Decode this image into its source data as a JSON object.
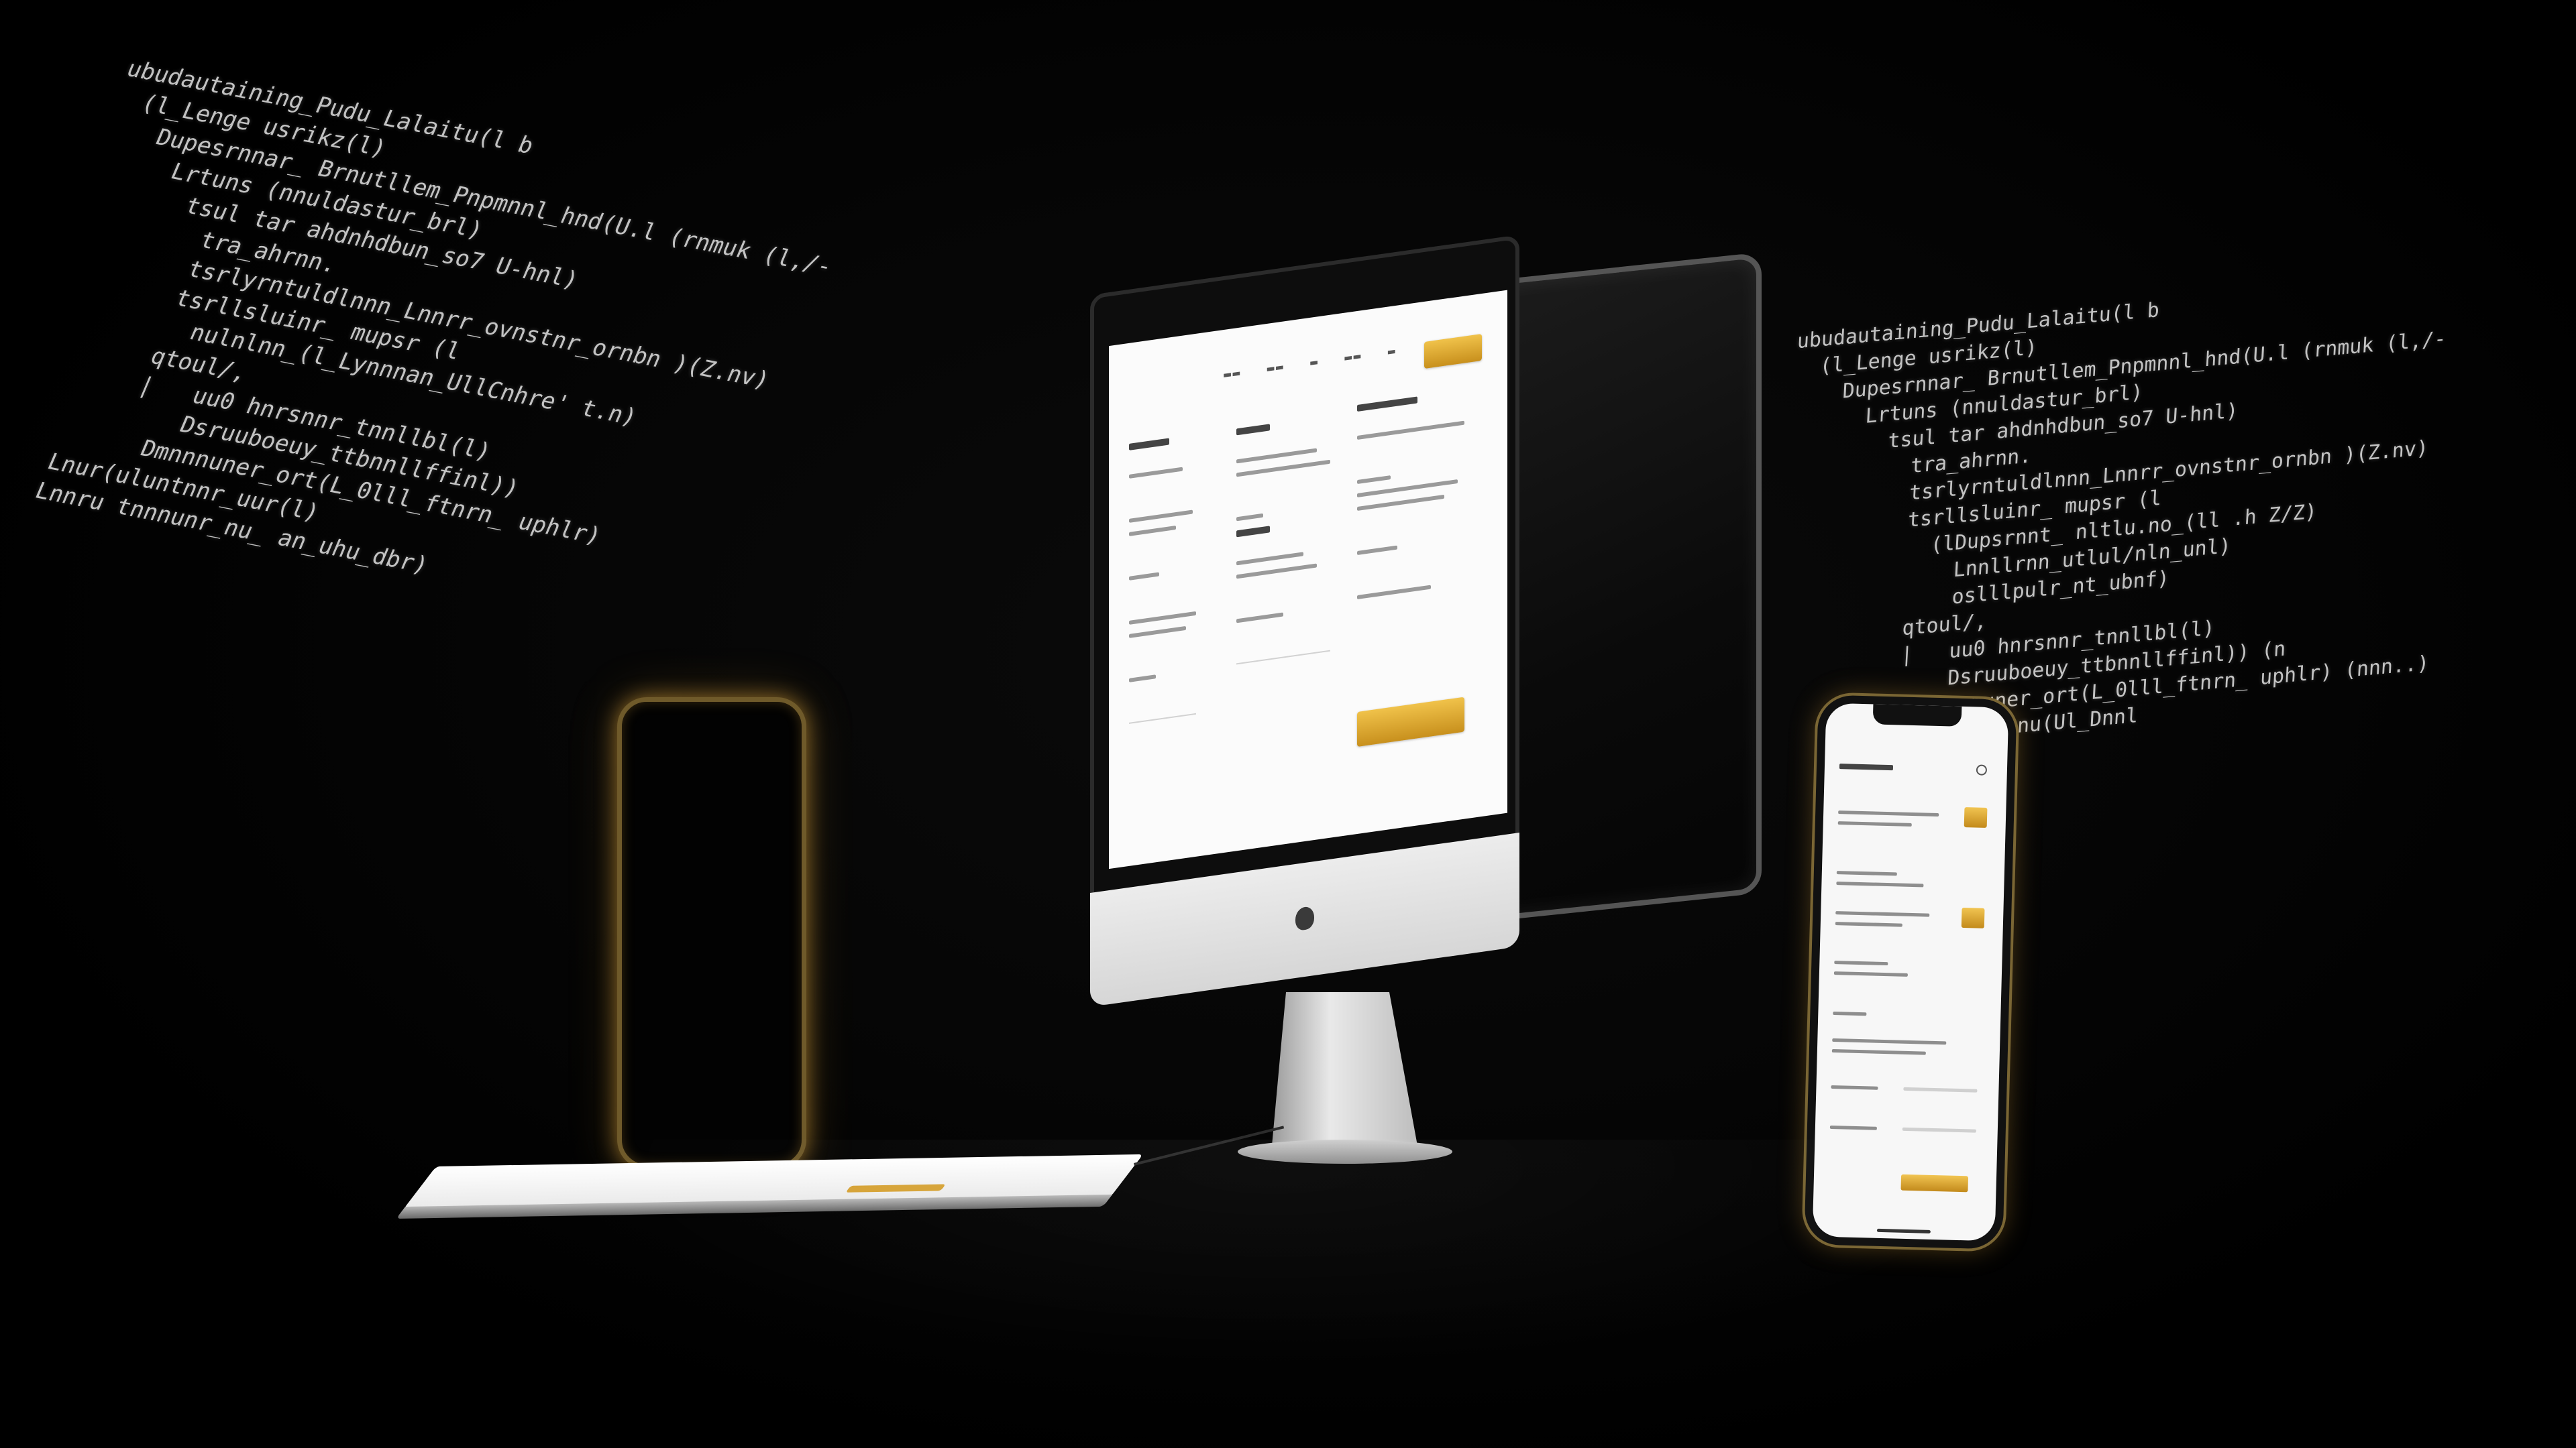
{
  "scene": {
    "description_colors": {
      "background": "#000000",
      "accent_gold": "#d6a337",
      "code_text": "#d8d8d8",
      "screen_white": "#fbfbfb"
    }
  },
  "code_left": {
    "lines": [
      {
        "text": "ubudautaining_Pudu_Lalaitu(l b"
      },
      {
        "text": "  (l_Lenge usrikz(l)"
      },
      {
        "text": "    Dupesrnnar_ Brnutllem_Pnpmnnl_hnd(U.l (rnmuk (l,/-"
      },
      {
        "text": "      Lrtuns (nnuldastur_brl)"
      },
      {
        "text": "        tsul tar ahdnhdbun_so7 U-hnl)"
      },
      {
        "text": "          tra_ahrnn."
      },
      {
        "text": "          tsrlyrntuldlnnn_Lnnrr_ovnstnr_ornbn )(Z.nv)"
      },
      {
        "text": "          tsrllsluinr_ mupsr (l"
      },
      {
        "text": "            nulnlnn_(l_Lynnnan_UllCnhre' t.n)"
      },
      {
        "text": "          qtoul/,"
      },
      {
        "text": "          |   uu0 hnrsnnr_tnnllbl(l)"
      },
      {
        "text": "              Dsruuboeuy_ttbnnllffinl))"
      },
      {
        "text": "            Dmnnnuner_ort(L_0lll_ftnrn_ uphlr)"
      },
      {
        "text": "      Lnur(uluntnnr_uur(l)"
      },
      {
        "text": "      Lnnru tnnnunr_nu_ an_uhu_dbr)"
      }
    ]
  },
  "code_right": {
    "lines": [
      {
        "text": "ubudautaining_Pudu_Lalaitu(l b"
      },
      {
        "text": "  (l_Lenge usrikz(l)"
      },
      {
        "text": "    Dupesrnnar_ Brnutllem_Pnpmnnl_hnd(U.l (rnmuk (l,/-"
      },
      {
        "text": "      Lrtuns (nnuldastur_brl)"
      },
      {
        "text": "        tsul tar ahdnhdbun_so7 U-hnl)"
      },
      {
        "text": "          tra_ahrnn."
      },
      {
        "text": "          tsrlyrntuldlnnn_Lnnrr_ovnstnr_ornbn )(Z.nv)"
      },
      {
        "text": "          tsrllsluinr_ mupsr (l"
      },
      {
        "text": "            (lDupsrnnt_ nltlu.no_(ll .h Z/Z)"
      },
      {
        "text": "              Lnnllrnn_utlul/nln_unl)"
      },
      {
        "text": "              oslllpulr_nt_ubnf)"
      },
      {
        "text": "          qtoul/,"
      },
      {
        "text": "          |   uu0 hnrsnnr_tnnllbl(l)"
      },
      {
        "text": "              Dsruuboeuy_ttbnnllffinl)) (n"
      },
      {
        "text": "            Dmnnnuner_ort(L_0lll_ftnrn_ uphlr) (nnn..)"
      },
      {
        "text": "                Lnnrnu(Ul_Dnnl"
      }
    ]
  },
  "imac": {
    "device": "iMac",
    "screen_content": "website form with gold buttons"
  },
  "phone_right": {
    "screen_content": "mobile website with gold accents"
  }
}
